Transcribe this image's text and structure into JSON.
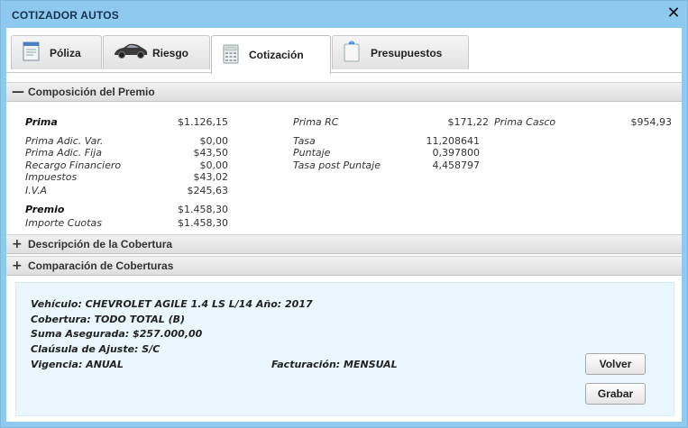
{
  "window": {
    "title": "COTIZADOR AUTOS",
    "close_icon": "close-icon",
    "accent": "#8ec9ef"
  },
  "tabs": [
    {
      "label": "Póliza",
      "icon": "document-icon"
    },
    {
      "label": "Riesgo",
      "icon": "car-icon"
    },
    {
      "label": "Cotización",
      "icon": "calculator-icon",
      "active": true
    },
    {
      "label": "Presupuestos",
      "icon": "clipboard-icon"
    }
  ],
  "composicion": {
    "header": "Composición del Premio",
    "col1": {
      "prima": {
        "label": "Prima",
        "value": "$1.126,15"
      },
      "rows": [
        {
          "label": "Prima Adic. Var.",
          "value": "$0,00"
        },
        {
          "label": "Prima Adic. Fija",
          "value": "$43,50"
        },
        {
          "label": "Recargo Financiero",
          "value": "$0,00"
        },
        {
          "label": "Impuestos",
          "value": "$43,02"
        },
        {
          "label": "I.V.A",
          "value": "$245,63"
        }
      ],
      "premio": {
        "label": "Premio",
        "value": "$1.458,30"
      },
      "cuotas": {
        "label": "Importe Cuotas",
        "value": "$1.458,30"
      }
    },
    "col2": {
      "prima_rc": {
        "label": "Prima RC",
        "value": "$171,22"
      },
      "rows": [
        {
          "label": "Tasa",
          "value": "11,208641"
        },
        {
          "label": "Puntaje",
          "value": "0,397800"
        },
        {
          "label": "Tasa post Puntaje",
          "value": "4,458797"
        }
      ]
    },
    "col3": {
      "prima_casco": {
        "label": "Prima Casco",
        "value": "$954,93"
      }
    }
  },
  "descripcion": {
    "header": "Descripción de la Cobertura"
  },
  "comparacion": {
    "header": "Comparación de Coberturas"
  },
  "info": {
    "vehiculo": "Vehículo: CHEVROLET AGILE 1.4 LS  L/14 Año: 2017",
    "cobertura": "Cobertura: TODO TOTAL (B)",
    "suma": "Suma Asegurada: $257.000,00",
    "clausula": "Claúsula de Ajuste: S/C",
    "vigencia": "Vigencia: ANUAL",
    "facturacion": "Facturación: MENSUAL"
  },
  "buttons": {
    "volver": "Volver",
    "grabar": "Grabar"
  }
}
